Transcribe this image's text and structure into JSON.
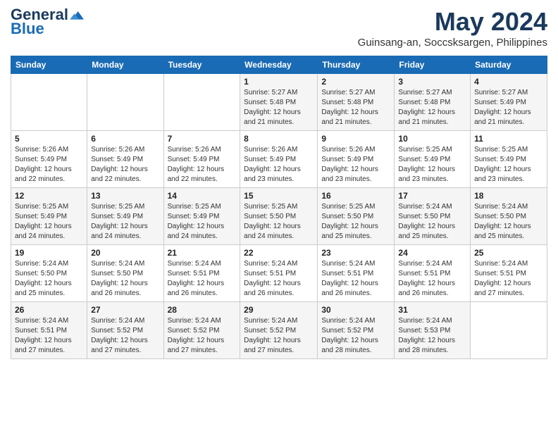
{
  "header": {
    "logo_general": "General",
    "logo_blue": "Blue",
    "month_title": "May 2024",
    "location": "Guinsang-an, Soccsksargen, Philippines"
  },
  "days_of_week": [
    "Sunday",
    "Monday",
    "Tuesday",
    "Wednesday",
    "Thursday",
    "Friday",
    "Saturday"
  ],
  "weeks": [
    {
      "days": [
        {
          "num": "",
          "info": ""
        },
        {
          "num": "",
          "info": ""
        },
        {
          "num": "",
          "info": ""
        },
        {
          "num": "1",
          "info": "Sunrise: 5:27 AM\nSunset: 5:48 PM\nDaylight: 12 hours\nand 21 minutes."
        },
        {
          "num": "2",
          "info": "Sunrise: 5:27 AM\nSunset: 5:48 PM\nDaylight: 12 hours\nand 21 minutes."
        },
        {
          "num": "3",
          "info": "Sunrise: 5:27 AM\nSunset: 5:48 PM\nDaylight: 12 hours\nand 21 minutes."
        },
        {
          "num": "4",
          "info": "Sunrise: 5:27 AM\nSunset: 5:49 PM\nDaylight: 12 hours\nand 21 minutes."
        }
      ]
    },
    {
      "days": [
        {
          "num": "5",
          "info": "Sunrise: 5:26 AM\nSunset: 5:49 PM\nDaylight: 12 hours\nand 22 minutes."
        },
        {
          "num": "6",
          "info": "Sunrise: 5:26 AM\nSunset: 5:49 PM\nDaylight: 12 hours\nand 22 minutes."
        },
        {
          "num": "7",
          "info": "Sunrise: 5:26 AM\nSunset: 5:49 PM\nDaylight: 12 hours\nand 22 minutes."
        },
        {
          "num": "8",
          "info": "Sunrise: 5:26 AM\nSunset: 5:49 PM\nDaylight: 12 hours\nand 23 minutes."
        },
        {
          "num": "9",
          "info": "Sunrise: 5:26 AM\nSunset: 5:49 PM\nDaylight: 12 hours\nand 23 minutes."
        },
        {
          "num": "10",
          "info": "Sunrise: 5:25 AM\nSunset: 5:49 PM\nDaylight: 12 hours\nand 23 minutes."
        },
        {
          "num": "11",
          "info": "Sunrise: 5:25 AM\nSunset: 5:49 PM\nDaylight: 12 hours\nand 23 minutes."
        }
      ]
    },
    {
      "days": [
        {
          "num": "12",
          "info": "Sunrise: 5:25 AM\nSunset: 5:49 PM\nDaylight: 12 hours\nand 24 minutes."
        },
        {
          "num": "13",
          "info": "Sunrise: 5:25 AM\nSunset: 5:49 PM\nDaylight: 12 hours\nand 24 minutes."
        },
        {
          "num": "14",
          "info": "Sunrise: 5:25 AM\nSunset: 5:49 PM\nDaylight: 12 hours\nand 24 minutes."
        },
        {
          "num": "15",
          "info": "Sunrise: 5:25 AM\nSunset: 5:50 PM\nDaylight: 12 hours\nand 24 minutes."
        },
        {
          "num": "16",
          "info": "Sunrise: 5:25 AM\nSunset: 5:50 PM\nDaylight: 12 hours\nand 25 minutes."
        },
        {
          "num": "17",
          "info": "Sunrise: 5:24 AM\nSunset: 5:50 PM\nDaylight: 12 hours\nand 25 minutes."
        },
        {
          "num": "18",
          "info": "Sunrise: 5:24 AM\nSunset: 5:50 PM\nDaylight: 12 hours\nand 25 minutes."
        }
      ]
    },
    {
      "days": [
        {
          "num": "19",
          "info": "Sunrise: 5:24 AM\nSunset: 5:50 PM\nDaylight: 12 hours\nand 25 minutes."
        },
        {
          "num": "20",
          "info": "Sunrise: 5:24 AM\nSunset: 5:50 PM\nDaylight: 12 hours\nand 26 minutes."
        },
        {
          "num": "21",
          "info": "Sunrise: 5:24 AM\nSunset: 5:51 PM\nDaylight: 12 hours\nand 26 minutes."
        },
        {
          "num": "22",
          "info": "Sunrise: 5:24 AM\nSunset: 5:51 PM\nDaylight: 12 hours\nand 26 minutes."
        },
        {
          "num": "23",
          "info": "Sunrise: 5:24 AM\nSunset: 5:51 PM\nDaylight: 12 hours\nand 26 minutes."
        },
        {
          "num": "24",
          "info": "Sunrise: 5:24 AM\nSunset: 5:51 PM\nDaylight: 12 hours\nand 26 minutes."
        },
        {
          "num": "25",
          "info": "Sunrise: 5:24 AM\nSunset: 5:51 PM\nDaylight: 12 hours\nand 27 minutes."
        }
      ]
    },
    {
      "days": [
        {
          "num": "26",
          "info": "Sunrise: 5:24 AM\nSunset: 5:51 PM\nDaylight: 12 hours\nand 27 minutes."
        },
        {
          "num": "27",
          "info": "Sunrise: 5:24 AM\nSunset: 5:52 PM\nDaylight: 12 hours\nand 27 minutes."
        },
        {
          "num": "28",
          "info": "Sunrise: 5:24 AM\nSunset: 5:52 PM\nDaylight: 12 hours\nand 27 minutes."
        },
        {
          "num": "29",
          "info": "Sunrise: 5:24 AM\nSunset: 5:52 PM\nDaylight: 12 hours\nand 27 minutes."
        },
        {
          "num": "30",
          "info": "Sunrise: 5:24 AM\nSunset: 5:52 PM\nDaylight: 12 hours\nand 28 minutes."
        },
        {
          "num": "31",
          "info": "Sunrise: 5:24 AM\nSunset: 5:53 PM\nDaylight: 12 hours\nand 28 minutes."
        },
        {
          "num": "",
          "info": ""
        }
      ]
    }
  ]
}
